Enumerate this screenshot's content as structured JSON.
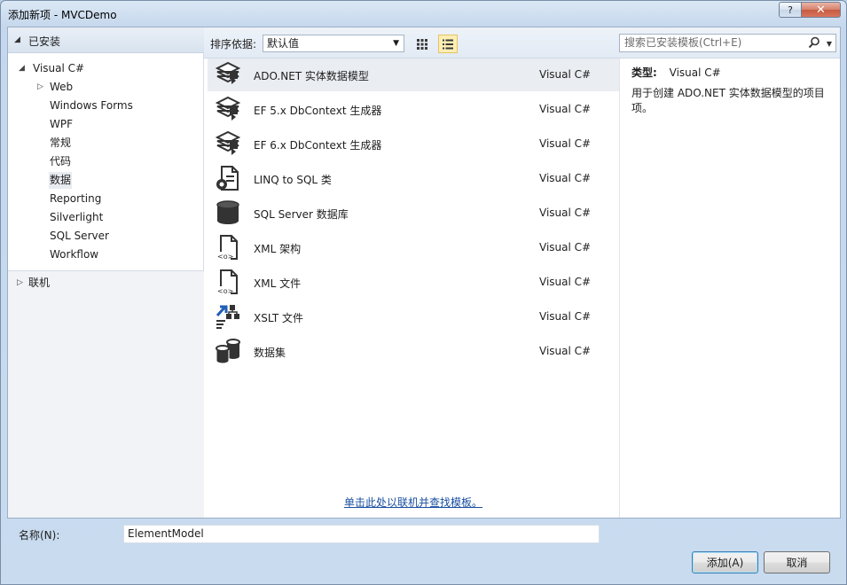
{
  "window": {
    "title": "添加新项 - MVCDemo",
    "help_label": "?",
    "close_label": "✕"
  },
  "left": {
    "installed_header": "已安装",
    "tree": [
      {
        "label": "Visual C#"
      },
      {
        "label": "Web"
      },
      {
        "label": "Windows Forms"
      },
      {
        "label": "WPF"
      },
      {
        "label": "常规"
      },
      {
        "label": "代码"
      },
      {
        "label": "数据",
        "selected": true
      },
      {
        "label": "Reporting"
      },
      {
        "label": "Silverlight"
      },
      {
        "label": "SQL Server"
      },
      {
        "label": "Workflow"
      }
    ],
    "online_label": "联机"
  },
  "toolbar": {
    "sort_label": "排序依据:",
    "sort_value": "默认值",
    "search_placeholder": "搜索已安装模板(Ctrl+E)"
  },
  "templates": [
    {
      "name": "ADO.NET 实体数据模型",
      "type": "Visual C#",
      "icon": "entity-model-icon",
      "selected": true
    },
    {
      "name": "EF 5.x DbContext 生成器",
      "type": "Visual C#",
      "icon": "dbcontext-generator-icon"
    },
    {
      "name": "EF 6.x DbContext 生成器",
      "type": "Visual C#",
      "icon": "dbcontext-generator-icon"
    },
    {
      "name": "LINQ to SQL 类",
      "type": "Visual C#",
      "icon": "linq-to-sql-icon"
    },
    {
      "name": "SQL Server 数据库",
      "type": "Visual C#",
      "icon": "database-icon"
    },
    {
      "name": "XML 架构",
      "type": "Visual C#",
      "icon": "xml-schema-icon"
    },
    {
      "name": "XML 文件",
      "type": "Visual C#",
      "icon": "xml-file-icon"
    },
    {
      "name": "XSLT 文件",
      "type": "Visual C#",
      "icon": "xslt-file-icon"
    },
    {
      "name": "数据集",
      "type": "Visual C#",
      "icon": "dataset-icon"
    }
  ],
  "online_link": "单击此处以联机并查找模板。",
  "detail": {
    "type_label": "类型:",
    "type_value": "Visual C#",
    "description": "用于创建 ADO.NET 实体数据模型的项目项。"
  },
  "footer": {
    "name_label": "名称(N):",
    "name_value": "ElementModel",
    "add_label": "添加(A)",
    "cancel_label": "取消"
  }
}
